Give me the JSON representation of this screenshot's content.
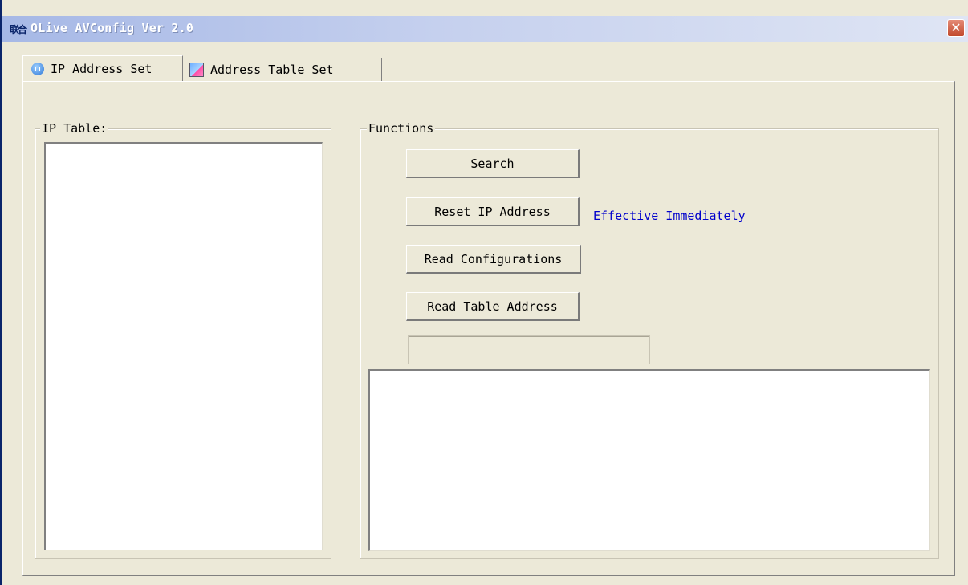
{
  "window": {
    "title": "OLive AVConfig Ver 2.0",
    "app_icon_label": "联合",
    "close_label": "✕"
  },
  "tabs": [
    {
      "label": "IP Address Set",
      "icon": "network-icon",
      "active": true
    },
    {
      "label": "Address Table Set",
      "icon": "address-book-icon",
      "active": false
    }
  ],
  "ip_table": {
    "label": "IP Table:",
    "items": []
  },
  "functions": {
    "label": "Functions",
    "buttons": {
      "search": "Search",
      "reset_ip": "Reset IP Address",
      "read_configurations": "Read Configurations",
      "read_table_address": "Read Table Address"
    },
    "effective_link": "Effective Immediately",
    "progress": 0,
    "output_text": ""
  },
  "colors": {
    "face": "#ECE9D8",
    "title_gradient_start": "#a6b8e6",
    "link": "#0000cc",
    "close": "#c1482b"
  }
}
